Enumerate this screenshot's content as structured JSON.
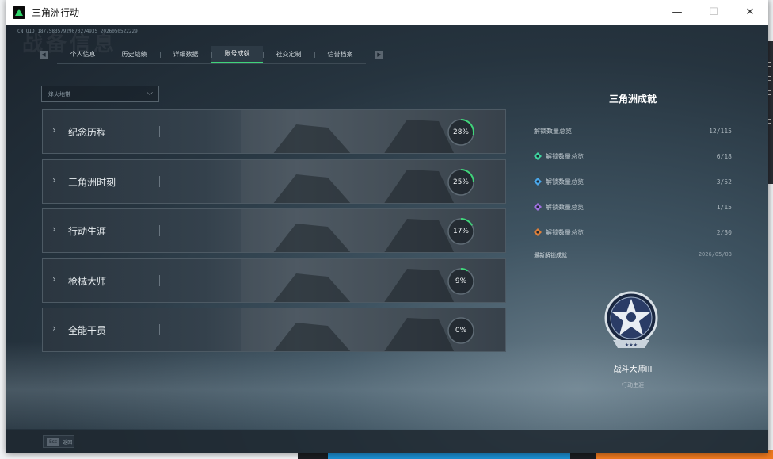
{
  "window": {
    "title": "三角洲行动",
    "controls": [
      "—",
      "☐",
      "✕"
    ]
  },
  "uid": "CN UID:18775835792907027493S 2026050522229",
  "watermark": "战备信息",
  "tabs": [
    {
      "label": "个人信息",
      "active": false
    },
    {
      "label": "历史战绩",
      "active": false
    },
    {
      "label": "详细数据",
      "active": false
    },
    {
      "label": "账号成就",
      "active": true
    },
    {
      "label": "社交定制",
      "active": false
    },
    {
      "label": "信誉档案",
      "active": false
    }
  ],
  "dropdown": {
    "value": "烽火地带"
  },
  "categories": [
    {
      "name": "纪念历程",
      "percent": 28
    },
    {
      "name": "三角洲时刻",
      "percent": 25
    },
    {
      "name": "行动生涯",
      "percent": 17
    },
    {
      "name": "枪械大师",
      "percent": 9
    },
    {
      "name": "全能干员",
      "percent": 0
    }
  ],
  "summary": {
    "title": "三角洲成就",
    "total_label": "解锁数量总览",
    "total_value": "12/115",
    "rows": [
      {
        "label": "解锁数量总览",
        "value": "6/18",
        "icon": "green-tier-icon",
        "color": "#3fd4a0"
      },
      {
        "label": "解锁数量总览",
        "value": "3/52",
        "icon": "blue-tier-icon",
        "color": "#4aa6e8"
      },
      {
        "label": "解锁数量总览",
        "value": "1/15",
        "icon": "purple-tier-icon",
        "color": "#a070e0"
      },
      {
        "label": "解锁数量总览",
        "value": "2/30",
        "icon": "orange-tier-icon",
        "color": "#e0803a"
      }
    ]
  },
  "latest": {
    "heading": "最新解锁成就",
    "date": "2026/05/03",
    "medal_name": "战斗大师III",
    "medal_category": "行动生涯"
  },
  "footer": {
    "key": "Esc",
    "label": "返回"
  },
  "colors": {
    "accent": "#3fd47a",
    "ring_track": "#5f6b75"
  }
}
